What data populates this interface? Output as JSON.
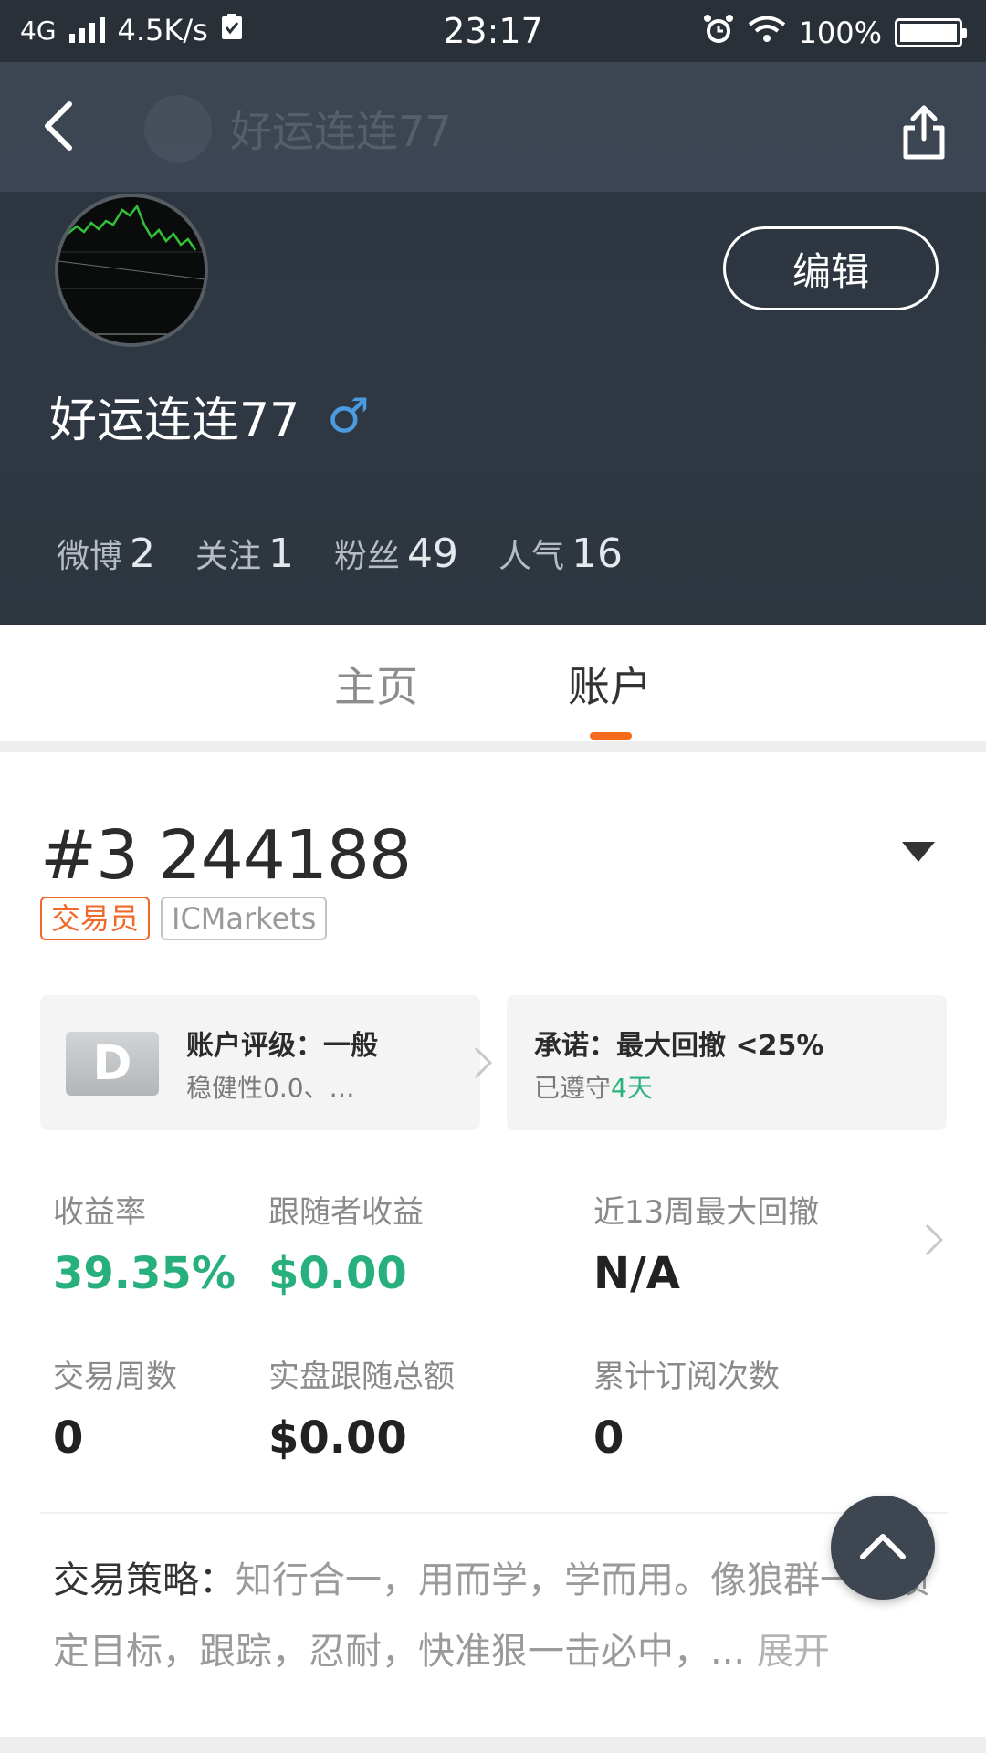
{
  "status_bar": {
    "network": "4G",
    "speed": "4.5K/s",
    "time": "23:17",
    "battery": "100%"
  },
  "navbar": {
    "title": "好运连连77"
  },
  "profile": {
    "username": "好运连连77",
    "gender_symbol": "♂",
    "edit_label": "编辑",
    "stats": [
      {
        "label": "微博",
        "value": "2"
      },
      {
        "label": "关注",
        "value": "1"
      },
      {
        "label": "粉丝",
        "value": "49"
      },
      {
        "label": "人气",
        "value": "16"
      }
    ]
  },
  "tabs": [
    {
      "label": "主页",
      "active": false
    },
    {
      "label": "账户",
      "active": true
    }
  ],
  "account": {
    "number": "#3 244188",
    "tags": [
      "交易员",
      "ICMarkets"
    ],
    "rating_card": {
      "badge": "D",
      "title": "账户评级：一般",
      "subtitle": "稳健性0.0、…"
    },
    "promise_card": {
      "title": "承诺：最大回撤 <25%",
      "subtitle_prefix": "已遵守",
      "subtitle_highlight": "4天"
    },
    "metrics": [
      {
        "label": "收益率",
        "value": "39.35%",
        "highlight": true
      },
      {
        "label": "跟随者收益",
        "value": "$0.00",
        "highlight": true
      },
      {
        "label": "近13周最大回撤",
        "value": "N/A",
        "highlight": false
      },
      {
        "label": "交易周数",
        "value": "0",
        "highlight": false
      },
      {
        "label": "实盘跟随总额",
        "value": "$0.00",
        "highlight": false
      },
      {
        "label": "累计订阅次数",
        "value": "0",
        "highlight": false
      }
    ],
    "strategy": {
      "heading": "交易策略：",
      "text": "知行合一，用而学，学而用。像狼群一样锁定目标，跟踪，忍耐，快准狠一击必中，...",
      "expand": "展开"
    }
  },
  "colors": {
    "accent_orange": "#f26a1b",
    "positive_green": "#27b07e",
    "header_bg": "#2f3843",
    "gender_blue": "#4a9be0"
  },
  "icons": [
    "back-arrow-icon",
    "share-icon",
    "dropdown-triangle-icon",
    "chevron-right-icon",
    "scroll-top-icon",
    "alarm-icon",
    "wifi-icon",
    "battery-icon",
    "signal-icon"
  ]
}
